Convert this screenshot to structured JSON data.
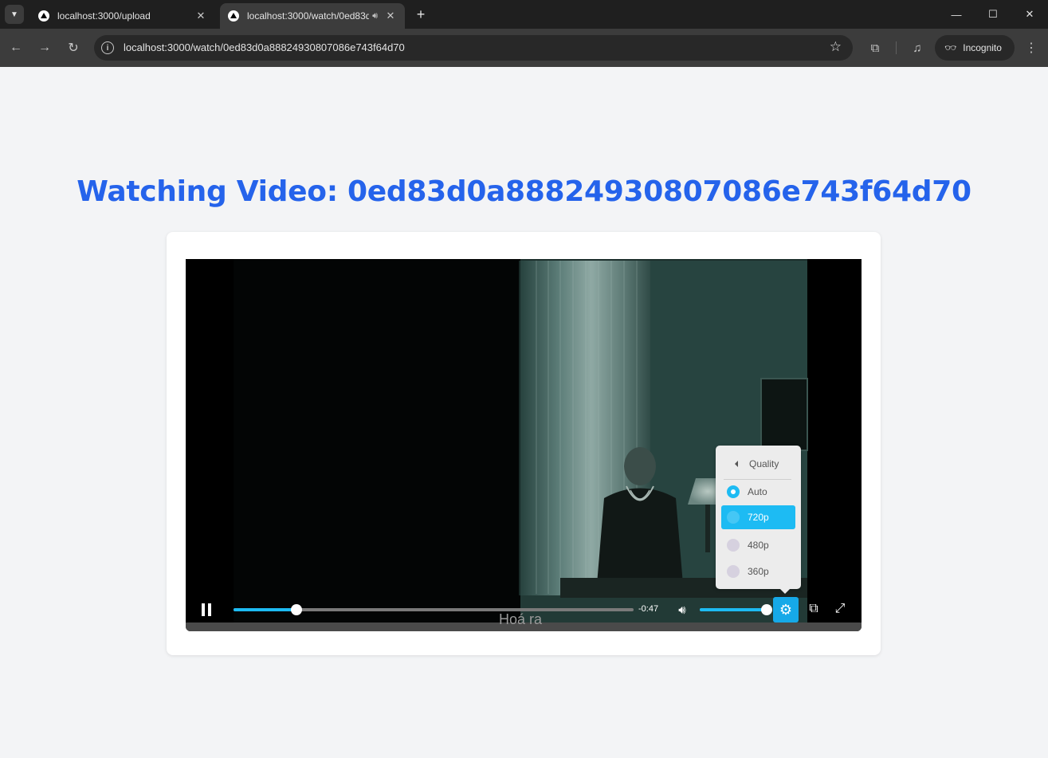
{
  "browser": {
    "tabs": [
      {
        "title": "localhost:3000/upload"
      },
      {
        "title": "localhost:3000/watch/0ed83d0a88824930807086e743f64d70"
      }
    ],
    "url": "localhost:3000/watch/0ed83d0a88824930807086e743f64d70",
    "incognito_label": "Incognito"
  },
  "page": {
    "title": "Watching Video: 0ed83d0a88824930807086e743f64d70"
  },
  "player": {
    "subtitle": "Hoá ra",
    "time_remaining": "-0:47",
    "progress": 0.157,
    "volume": 1.0,
    "quality_menu": {
      "header": "Quality",
      "options": [
        {
          "label": "Auto",
          "selected": true
        },
        {
          "label": "720p",
          "selected": false,
          "highlighted": true
        },
        {
          "label": "480p",
          "selected": false
        },
        {
          "label": "360p",
          "selected": false
        }
      ]
    },
    "accent_color": "#1dbbf3"
  },
  "colors": {
    "title": "#2563eb",
    "page_background": "#f3f4f6"
  }
}
